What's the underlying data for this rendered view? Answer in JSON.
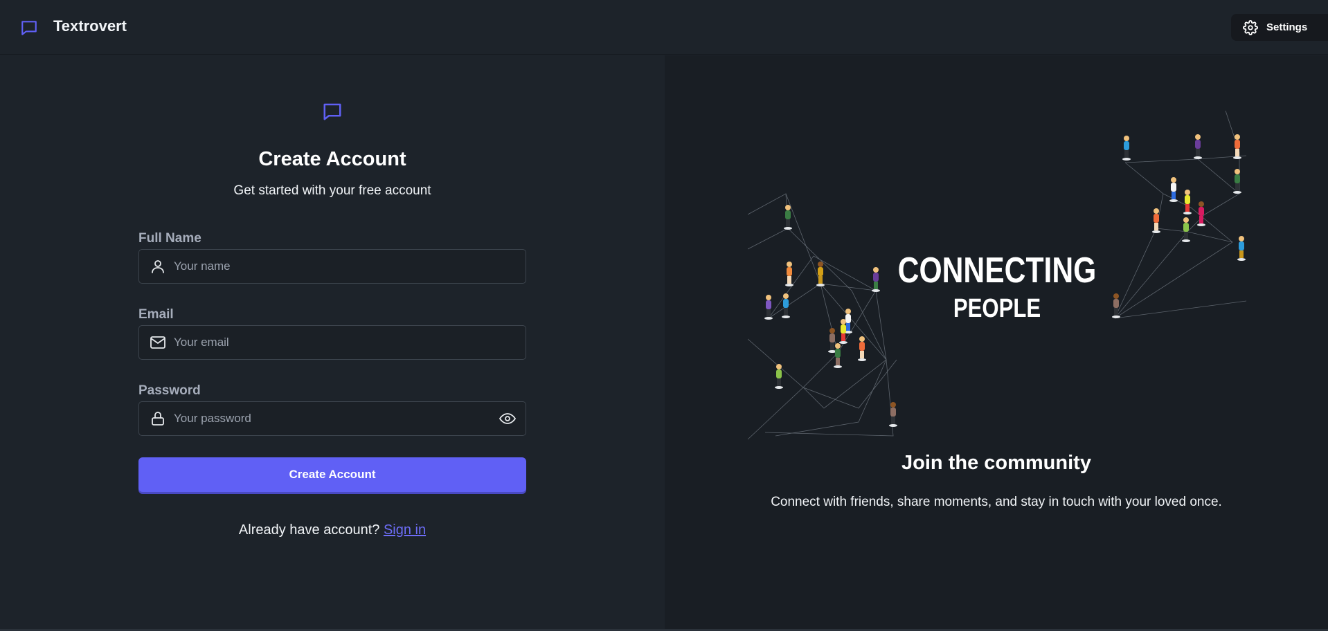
{
  "header": {
    "brand_name": "Textrovert",
    "settings_label": "Settings"
  },
  "form": {
    "title": "Create Account",
    "subtitle": "Get started with your free account",
    "fields": [
      {
        "label": "Full Name",
        "placeholder": "Your name",
        "value": "",
        "icon": "user-icon"
      },
      {
        "label": "Email",
        "placeholder": "Your email",
        "value": "",
        "icon": "mail-icon"
      },
      {
        "label": "Password",
        "placeholder": "Your password",
        "value": "",
        "icon": "lock-icon"
      }
    ],
    "submit_label": "Create Account",
    "signin_prompt": "Already have account?",
    "signin_link": "Sign in"
  },
  "side": {
    "illustration_line1": "CONNECTING",
    "illustration_line2": "PEOPLE",
    "title": "Join the community",
    "subtitle": "Connect with friends, share moments, and stay in touch with your loved once."
  },
  "colors": {
    "accent": "#6060f5",
    "background": "#1d232a",
    "panel": "#191e24"
  }
}
